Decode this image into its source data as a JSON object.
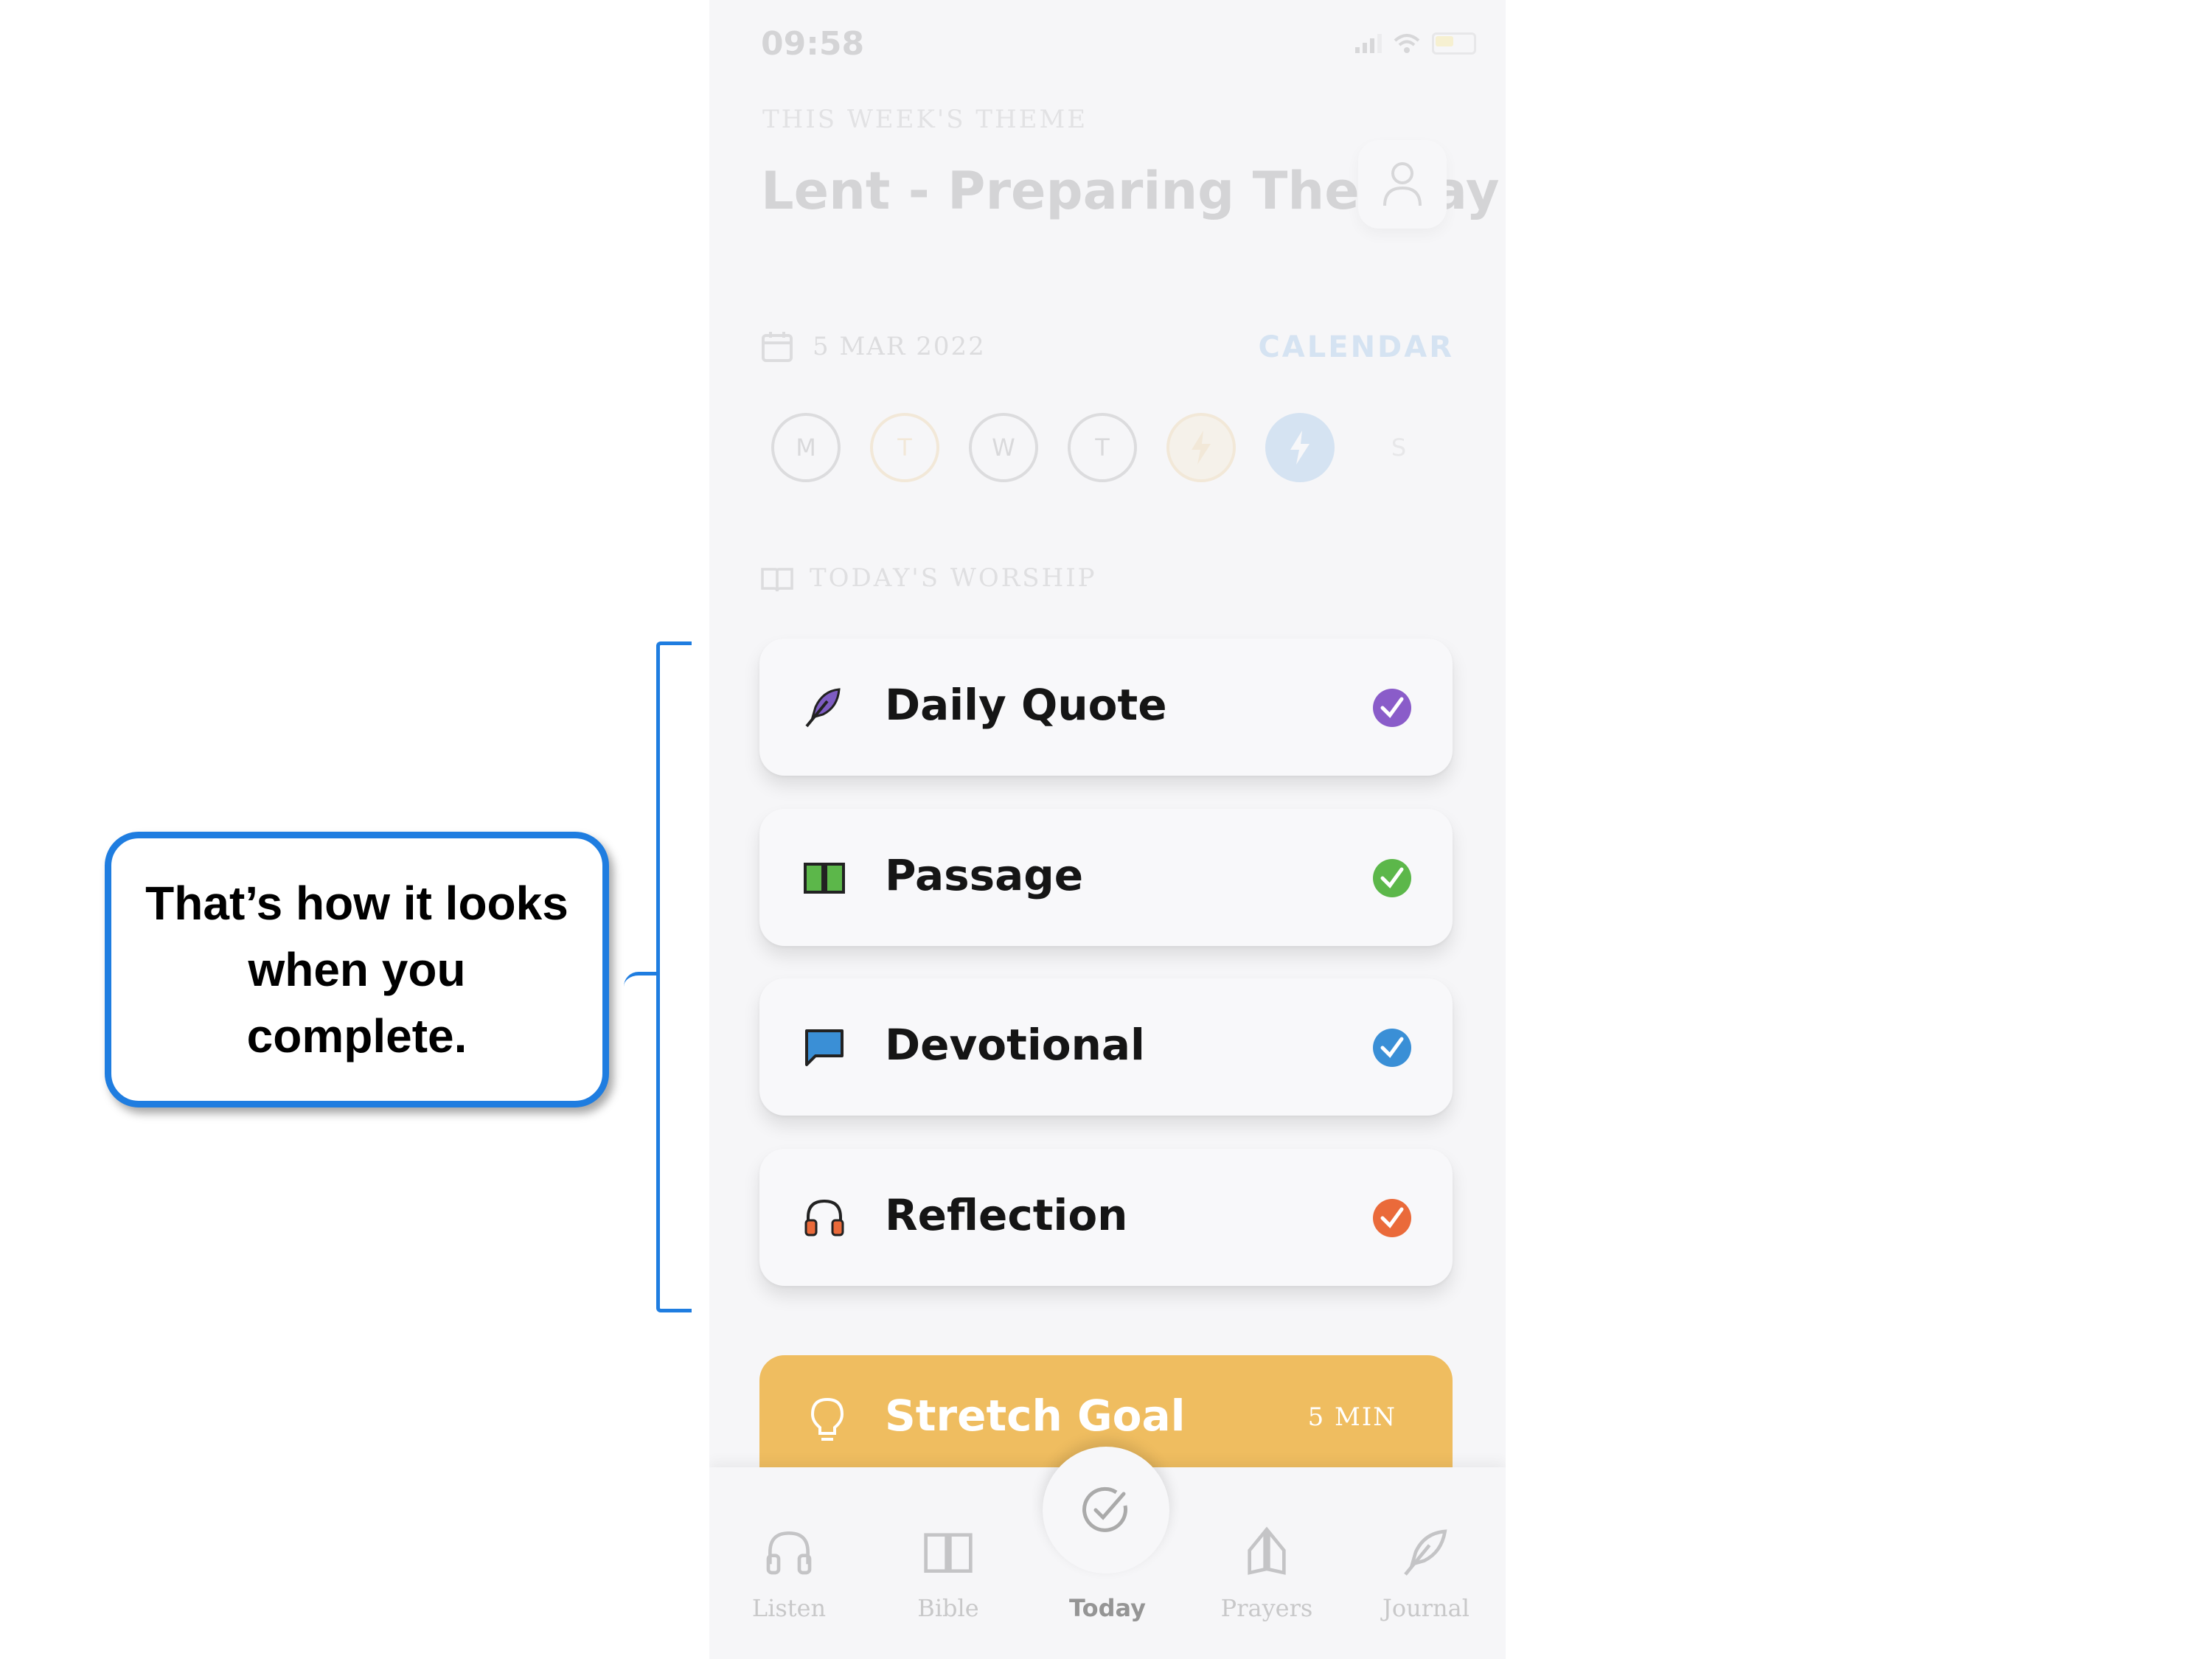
{
  "status_bar": {
    "time": "09:58"
  },
  "header": {
    "theme_label": "THIS WEEK'S THEME",
    "theme_title": "Lent - Preparing The Way"
  },
  "date_bar": {
    "date": "5 MAR 2022",
    "calendar_link": "CALENDAR"
  },
  "week_days": [
    {
      "letter": "M",
      "color": "#555555"
    },
    {
      "letter": "T",
      "color": "#e0a030"
    },
    {
      "letter": "W",
      "color": "#555555"
    },
    {
      "letter": "T",
      "color": "#555555"
    },
    {
      "letter": "",
      "color": "#e0a030",
      "icon": "bolt-icon"
    },
    {
      "letter": "",
      "color": "#2b7fd1",
      "icon": "bolt-icon"
    },
    {
      "letter": "S",
      "color": "#999999"
    }
  ],
  "worship": {
    "section_label": "TODAY'S WORSHIP",
    "items": [
      {
        "label": "Daily Quote",
        "icon": "feather-icon",
        "check_color": "#8a5cc9"
      },
      {
        "label": "Passage",
        "icon": "book-icon",
        "check_color": "#5cb74a"
      },
      {
        "label": "Devotional",
        "icon": "chat-bubble-icon",
        "check_color": "#3a8fd6"
      },
      {
        "label": "Reflection",
        "icon": "headphones-icon",
        "check_color": "#ea6a3a"
      }
    ]
  },
  "stretch_goal": {
    "label": "Stretch Goal",
    "duration": "5 MIN",
    "icon": "lightbulb-icon"
  },
  "tab_bar": {
    "tabs": [
      {
        "label": "Listen",
        "icon": "headphones-icon"
      },
      {
        "label": "Bible",
        "icon": "book-icon"
      },
      {
        "label": "Today",
        "icon": "check-circle-icon",
        "active": true
      },
      {
        "label": "Prayers",
        "icon": "praying-hands-icon"
      },
      {
        "label": "Journal",
        "icon": "feather-icon"
      }
    ]
  },
  "annotation": {
    "text": "That’s how it looks when you complete."
  }
}
